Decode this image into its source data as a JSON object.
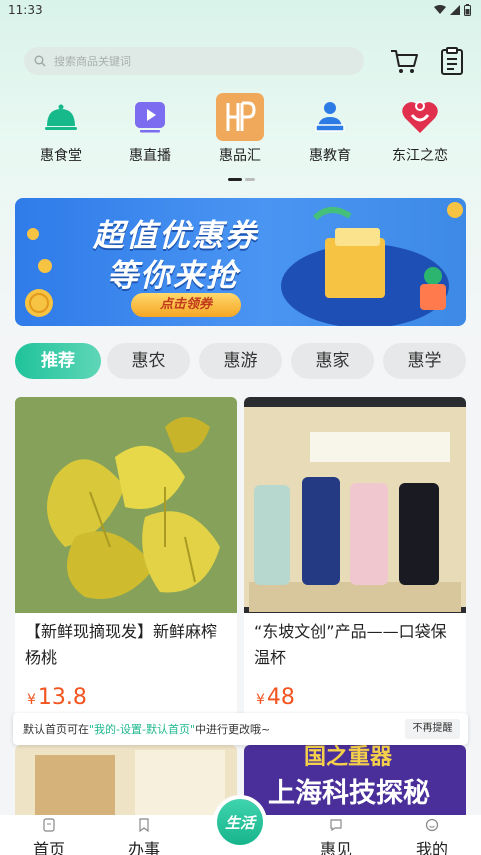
{
  "status_bar": {
    "time": "11:33"
  },
  "search": {
    "placeholder": "搜索商品关键词"
  },
  "quick_nav": [
    {
      "label": "惠食堂",
      "icon": "cloche-icon"
    },
    {
      "label": "惠直播",
      "icon": "play-icon"
    },
    {
      "label": "惠品汇",
      "icon": "hp-logo-icon"
    },
    {
      "label": "惠教育",
      "icon": "teacher-icon"
    },
    {
      "label": "东江之恋",
      "icon": "heart-logo-icon"
    }
  ],
  "banner": {
    "line1": "超值优惠券",
    "line2": "等你来抢",
    "button": "点击领券"
  },
  "tabs": [
    "推荐",
    "惠农",
    "惠游",
    "惠家",
    "惠学"
  ],
  "products": [
    {
      "title": "【新鲜现摘现发】新鲜麻榨杨桃",
      "currency": "¥",
      "price": "13.8"
    },
    {
      "title": "“东坡文创”产品——口袋保温杯",
      "currency": "¥",
      "price": "48"
    }
  ],
  "lower_cards": {
    "right_text": "上海科技探秘",
    "right_top": "国之重器"
  },
  "toast": {
    "prefix": "默认首页可在",
    "highlight": "\"我的-设置-默认首页\"",
    "suffix": "中进行更改哦~",
    "button": "不再提醒"
  },
  "bottom_nav": [
    "首页",
    "办事",
    "生活",
    "惠见",
    "我的"
  ],
  "colors": {
    "accent": "#1fc39b",
    "price": "#f2551f",
    "banner": "#2f7be9"
  }
}
